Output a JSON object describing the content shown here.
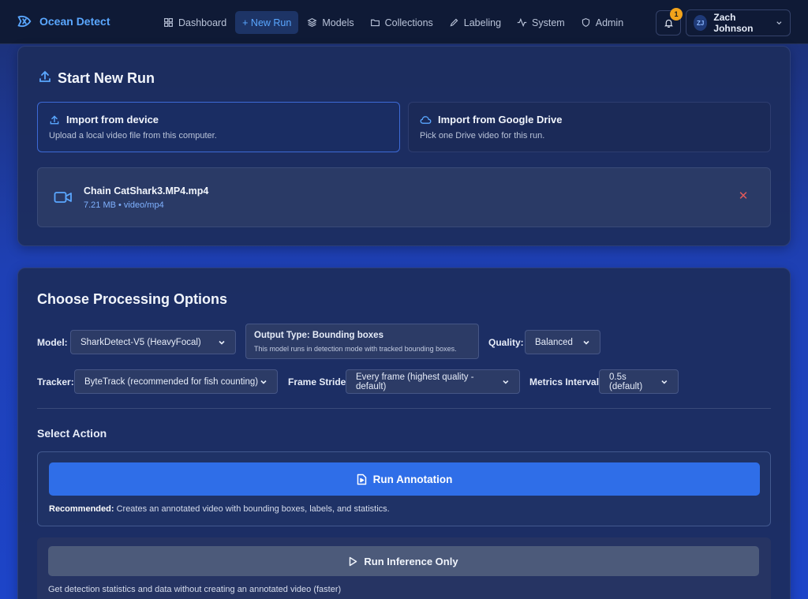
{
  "nav": {
    "brand": "Ocean Detect",
    "items": [
      {
        "label": "Dashboard",
        "icon": "grid-icon"
      },
      {
        "label": "+ New Run",
        "icon": "plus-icon"
      },
      {
        "label": "Models",
        "icon": "layers-icon"
      },
      {
        "label": "Collections",
        "icon": "folder-icon"
      },
      {
        "label": "Labeling",
        "icon": "pencil-icon"
      },
      {
        "label": "System",
        "icon": "activity-icon"
      },
      {
        "label": "Admin",
        "icon": "shield-icon"
      }
    ],
    "active_index": 1,
    "notification_count": "1",
    "user": {
      "initials": "ZJ",
      "name": "Zach Johnson"
    }
  },
  "start": {
    "title": "Start New Run",
    "import_device": {
      "title": "Import from device",
      "subtitle": "Upload a local video file from this computer."
    },
    "import_drive": {
      "title": "Import from Google Drive",
      "subtitle": "Pick one Drive video for this run."
    },
    "file": {
      "name": "Chain CatShark3.MP4.mp4",
      "meta": "7.21 MB • video/mp4"
    }
  },
  "options": {
    "title": "Choose Processing Options",
    "model_label": "Model:",
    "model_value": "SharkDetect-V5 (HeavyFocal)",
    "output_type_title": "Output Type: Bounding boxes",
    "output_type_sub": "This model runs in detection mode with tracked bounding boxes.",
    "quality_label": "Quality:",
    "quality_value": "Balanced",
    "tracker_label": "Tracker:",
    "tracker_value": "ByteTrack (recommended for fish counting)",
    "stride_label": "Frame Stride:",
    "stride_value": "Every frame (highest quality - default)",
    "metrics_label": "Metrics Interval:",
    "metrics_value": "0.5s (default)"
  },
  "action": {
    "title": "Select Action",
    "annotate_label": "Run Annotation",
    "annotate_note_bold": "Recommended:",
    "annotate_note": " Creates an annotated video with bounding boxes, labels, and statistics.",
    "inference_label": "Run Inference Only",
    "inference_note": "Get detection statistics and data without creating an annotated video (faster)"
  },
  "colors": {
    "accent": "#2f6ee8",
    "brand": "#5aa7ff",
    "danger": "#e05a5a",
    "badge": "#f2a31b"
  }
}
